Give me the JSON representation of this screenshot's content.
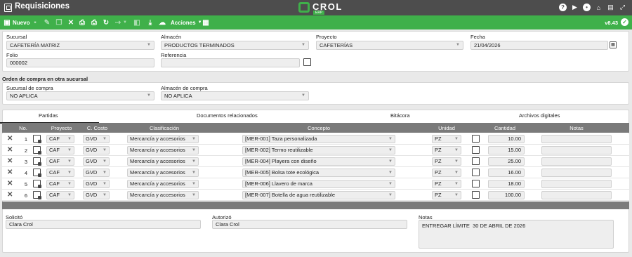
{
  "window": {
    "title": "Requisiciones"
  },
  "brand": {
    "name": "CROL",
    "sub": "ERP"
  },
  "toolbar": {
    "new_label": "Nuevo",
    "actions_label": "Acciones",
    "version": "v8.43"
  },
  "header": {
    "sucursal": {
      "label": "Sucursal",
      "value": "CAFETERÍA MATRIZ"
    },
    "almacen": {
      "label": "Almacén",
      "value": "PRODUCTOS TERMINADOS"
    },
    "proyecto": {
      "label": "Proyecto",
      "value": "CAFETERÍAS"
    },
    "fecha": {
      "label": "Fecha",
      "value": "21/04/2026"
    },
    "folio": {
      "label": "Folio",
      "value": "000002"
    },
    "referencia": {
      "label": "Referencia",
      "value": ""
    }
  },
  "other_branch": {
    "title": "Orden de compra en otra sucursal",
    "sucursal": {
      "label": "Sucursal de compra",
      "value": "NO APLICA"
    },
    "almacen": {
      "label": "Almacén de compra",
      "value": "NO APLICA"
    }
  },
  "tabs": [
    "Partidas",
    "Documentos relacionados",
    "Bitácora",
    "Archivos digitales"
  ],
  "grid": {
    "columns": [
      "No.",
      "Proyecto",
      "C. Costo",
      "Clasificación",
      "Concepto",
      "Unidad",
      "Cantidad",
      "Notas"
    ],
    "rows": [
      {
        "no": "1",
        "proyecto": "CAF",
        "costo": "GVD",
        "clasificacion": "Mercancía y accesorios",
        "concepto": "[MER-001] Taza personalizada",
        "unidad": "PZ",
        "cantidad": "10.00",
        "notas": ""
      },
      {
        "no": "2",
        "proyecto": "CAF",
        "costo": "GVD",
        "clasificacion": "Mercancía y accesorios",
        "concepto": "[MER-002] Termo reutilizable",
        "unidad": "PZ",
        "cantidad": "15.00",
        "notas": ""
      },
      {
        "no": "3",
        "proyecto": "CAF",
        "costo": "GVD",
        "clasificacion": "Mercancía y accesorios",
        "concepto": "[MER-004] Playera con diseño",
        "unidad": "PZ",
        "cantidad": "25.00",
        "notas": ""
      },
      {
        "no": "4",
        "proyecto": "CAF",
        "costo": "GVD",
        "clasificacion": "Mercancía y accesorios",
        "concepto": "[MER-005] Bolsa tote ecológica",
        "unidad": "PZ",
        "cantidad": "16.00",
        "notas": ""
      },
      {
        "no": "5",
        "proyecto": "CAF",
        "costo": "GVD",
        "clasificacion": "Mercancía y accesorios",
        "concepto": "[MER-006] Llavero de marca",
        "unidad": "PZ",
        "cantidad": "18.00",
        "notas": ""
      },
      {
        "no": "6",
        "proyecto": "CAF",
        "costo": "GVD",
        "clasificacion": "Mercancía y accesorios",
        "concepto": "[MER-007] Botella de agua reutilizable",
        "unidad": "PZ",
        "cantidad": "100.00",
        "notas": ""
      }
    ]
  },
  "footer": {
    "solicito": {
      "label": "Solicitó",
      "value": "Clara Crol"
    },
    "autorizo": {
      "label": "Autorizó",
      "value": "Clara Crol"
    },
    "notas": {
      "label": "Notas",
      "value": "ENTREGAR LÍMITE  30 DE ABRIL DE 2026"
    }
  },
  "colors": {
    "accent": "#3fb04a",
    "titlebar": "#4d4d4d",
    "grid_header": "#7a7a7a"
  }
}
